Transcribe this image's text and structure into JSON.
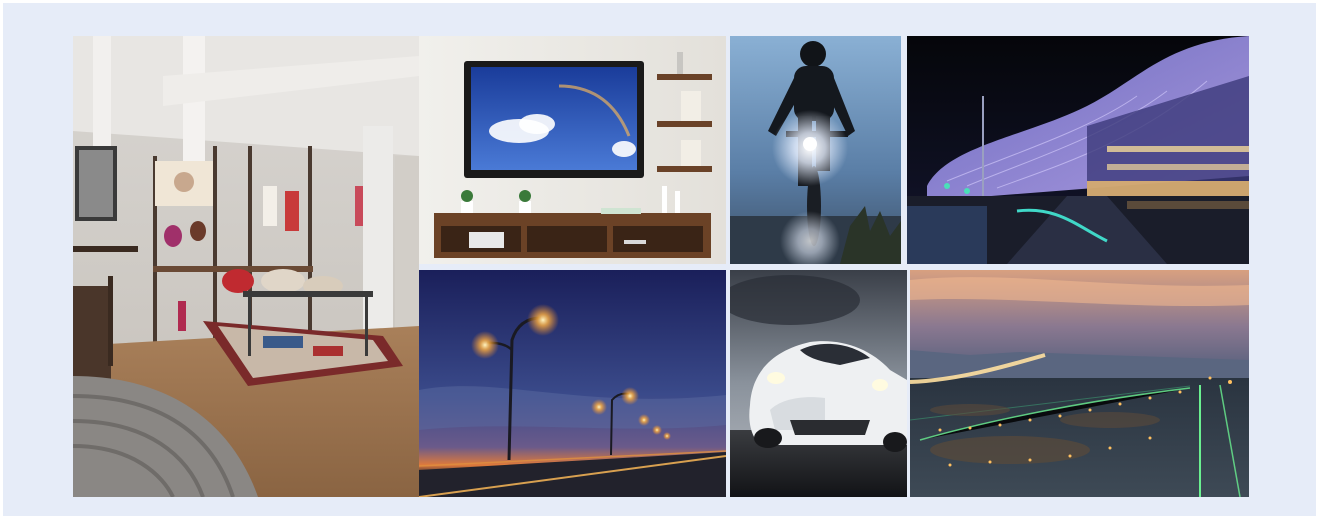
{
  "collage": {
    "background_color": "#e6ecf8",
    "photos": [
      {
        "subject": "retail-store-interior-icon"
      },
      {
        "subject": "living-room-tv-icon"
      },
      {
        "subject": "night-cyclist-headlight-icon"
      },
      {
        "subject": "illuminated-hotel-night-icon"
      },
      {
        "subject": "street-lights-dusk-icon"
      },
      {
        "subject": "white-sports-car-icon"
      },
      {
        "subject": "airport-runway-lights-icon"
      }
    ]
  }
}
